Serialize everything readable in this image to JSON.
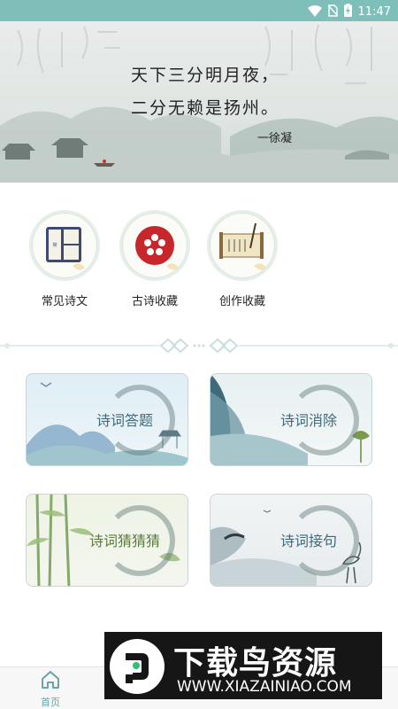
{
  "status_bar": {
    "time": "11:47",
    "icons": [
      "wifi-icon",
      "no-sim-icon",
      "battery-charging-icon"
    ]
  },
  "hero": {
    "poem_line1": "天下三分明月夜，",
    "poem_line2": "二分无赖是扬州。",
    "author": "一徐凝"
  },
  "categories": [
    {
      "label": "常见诗文",
      "icon": "book-icon"
    },
    {
      "label": "古诗收藏",
      "icon": "plum-blossom-icon"
    },
    {
      "label": "创作收藏",
      "icon": "scroll-brush-icon"
    }
  ],
  "games": [
    {
      "title": "诗词答题"
    },
    {
      "title": "诗词消除"
    },
    {
      "title": "诗词猜猜猜"
    },
    {
      "title": "诗词接句"
    }
  ],
  "bottom_nav": {
    "home_label": "首页",
    "active": "home"
  },
  "watermark": {
    "title": "下载鸟资源",
    "url": "WWW.XIAZAINIAO.COM"
  },
  "colors": {
    "status_bar": "#7fbfba",
    "accent": "#6aa4a8",
    "card_title": "#406a7b"
  }
}
